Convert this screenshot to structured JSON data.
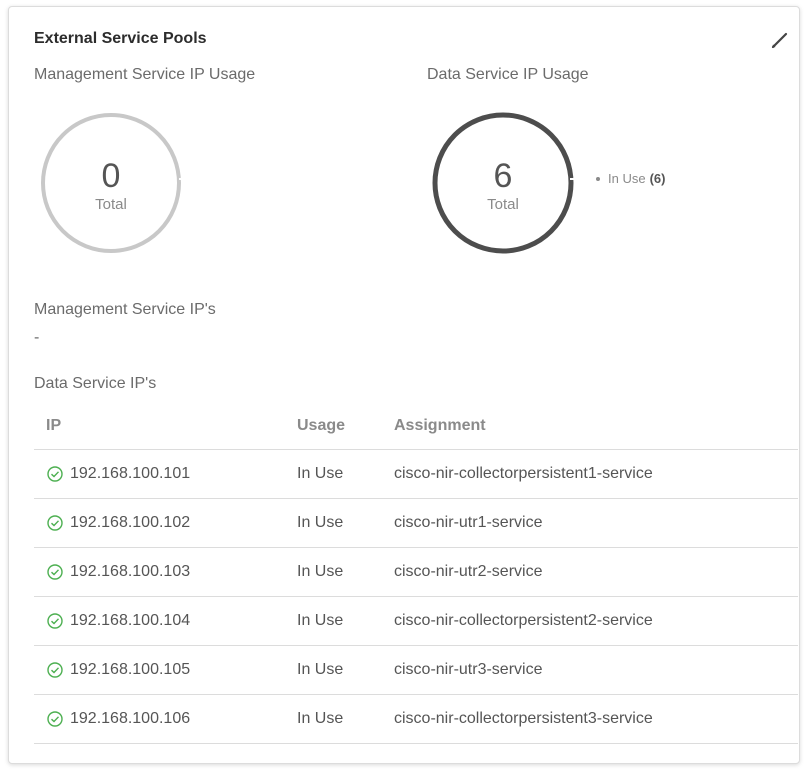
{
  "panel": {
    "title": "External Service Pools",
    "edit_icon": "pencil-icon"
  },
  "management_usage": {
    "label": "Management Service IP Usage",
    "total": "0",
    "total_label": "Total"
  },
  "data_usage": {
    "label": "Data Service IP Usage",
    "total": "6",
    "total_label": "Total",
    "legend": {
      "label": "In Use",
      "count": "(6)"
    }
  },
  "management_ips": {
    "label": "Management Service IP's",
    "value": "-"
  },
  "data_ips": {
    "label": "Data Service IP's",
    "columns": {
      "ip": "IP",
      "usage": "Usage",
      "assignment": "Assignment"
    },
    "rows": [
      {
        "ip": "192.168.100.101",
        "usage": "In Use",
        "assignment": "cisco-nir-collectorpersistent1-service"
      },
      {
        "ip": "192.168.100.102",
        "usage": "In Use",
        "assignment": "cisco-nir-utr1-service"
      },
      {
        "ip": "192.168.100.103",
        "usage": "In Use",
        "assignment": "cisco-nir-utr2-service"
      },
      {
        "ip": "192.168.100.104",
        "usage": "In Use",
        "assignment": "cisco-nir-collectorpersistent2-service"
      },
      {
        "ip": "192.168.100.105",
        "usage": "In Use",
        "assignment": "cisco-nir-utr3-service"
      },
      {
        "ip": "192.168.100.106",
        "usage": "In Use",
        "assignment": "cisco-nir-collectorpersistent3-service"
      }
    ]
  },
  "colors": {
    "ring_empty": "#c8c8c8",
    "ring_in_use": "#4d4d4d",
    "status_ok": "#4caf50"
  }
}
